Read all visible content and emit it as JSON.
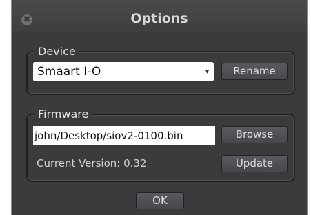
{
  "window": {
    "title": "Options",
    "close_glyph": "✖"
  },
  "device": {
    "group_label": "Device",
    "selected": "Smaart I-O",
    "arrow_glyph": "▾",
    "rename_label": "Rename"
  },
  "firmware": {
    "group_label": "Firmware",
    "path_value": "john/Desktop/siov2-0100.bin",
    "browse_label": "Browse",
    "version_text": "Current Version: 0.32",
    "update_label": "Update"
  },
  "footer": {
    "ok_label": "OK"
  }
}
